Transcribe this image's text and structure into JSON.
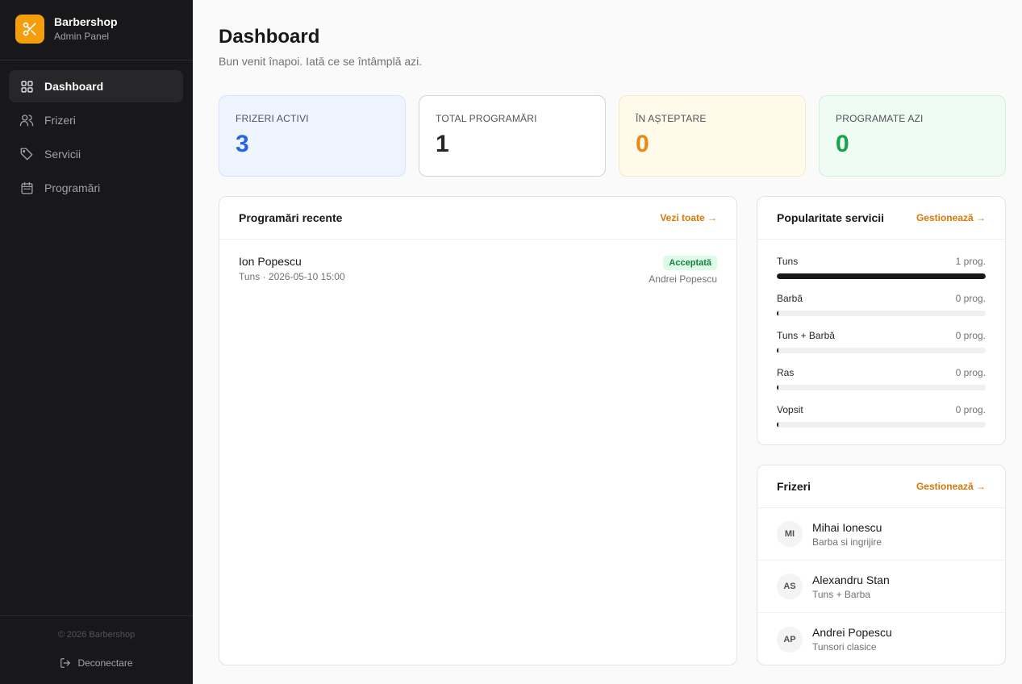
{
  "brand": {
    "name": "Barbershop",
    "subtitle": "Admin Panel",
    "logo_icon": "scissors-icon",
    "accent": "#f59e0b"
  },
  "sidebar": {
    "items": [
      {
        "label": "Dashboard",
        "icon": "grid-icon",
        "active": true
      },
      {
        "label": "Frizeri",
        "icon": "users-icon",
        "active": false
      },
      {
        "label": "Servicii",
        "icon": "tag-icon",
        "active": false
      },
      {
        "label": "Programări",
        "icon": "calendar-icon",
        "active": false
      }
    ],
    "copyright": "© 2026 Barbershop",
    "logout_label": "Deconectare"
  },
  "header": {
    "title": "Dashboard",
    "subtitle": "Bun venit înapoi. Iată ce se întâmplă azi."
  },
  "stats": [
    {
      "label": "FRIZERI ACTIVI",
      "value": "3",
      "color": "#2563eb"
    },
    {
      "label": "TOTAL PROGRAMĂRI",
      "value": "1",
      "color": "#27272a"
    },
    {
      "label": "ÎN AȘTEPTARE",
      "value": "0",
      "color": "#ea8a12"
    },
    {
      "label": "PROGRAMATE AZI",
      "value": "0",
      "color": "#16a34a"
    }
  ],
  "recent": {
    "title": "Programări recente",
    "link": "Vezi toate →",
    "items": [
      {
        "client": "Ion Popescu",
        "meta": "Tuns · 2026-05-10 15:00",
        "status": "Acceptată",
        "barber": "Andrei Popescu"
      }
    ]
  },
  "popularity": {
    "title": "Popularitate servicii",
    "link": "Gestionează →",
    "items": [
      {
        "name": "Tuns",
        "count": "1 prog.",
        "share": 1.0
      },
      {
        "name": "Barbă",
        "count": "0 prog.",
        "share": 0
      },
      {
        "name": "Tuns + Barbă",
        "count": "0 prog.",
        "share": 0
      },
      {
        "name": "Ras",
        "count": "0 prog.",
        "share": 0
      },
      {
        "name": "Vopsit",
        "count": "0 prog.",
        "share": 0
      }
    ]
  },
  "barbers": {
    "title": "Frizeri",
    "link": "Gestionează →",
    "items": [
      {
        "initials": "MI",
        "name": "Mihai Ionescu",
        "specialty": "Barba si ingrijire"
      },
      {
        "initials": "AS",
        "name": "Alexandru Stan",
        "specialty": "Tuns + Barba"
      },
      {
        "initials": "AP",
        "name": "Andrei Popescu",
        "specialty": "Tunsori clasice"
      }
    ]
  }
}
